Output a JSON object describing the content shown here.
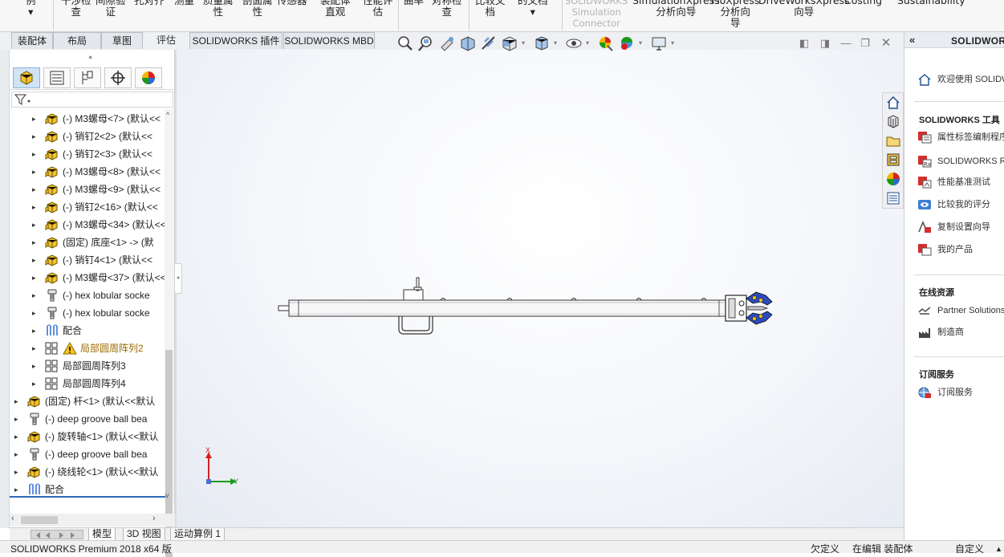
{
  "ribbon": {
    "items": [
      {
        "label": "例\n▾",
        "disabled": false
      },
      {
        "label": "干涉检\n查",
        "disabled": false
      },
      {
        "label": "间隙验\n证",
        "disabled": false
      },
      {
        "label": "孔对齐",
        "disabled": false
      },
      {
        "label": "测量",
        "disabled": false
      },
      {
        "label": "质量属\n性",
        "disabled": false
      },
      {
        "label": "剖面属\n性",
        "disabled": false
      },
      {
        "label": "传感器",
        "disabled": false
      },
      {
        "label": "装配体\n直观",
        "disabled": false
      },
      {
        "label": "性能评\n估",
        "disabled": false
      },
      {
        "label": "曲率",
        "disabled": false
      },
      {
        "label": "对称检\n查",
        "disabled": false
      },
      {
        "label": "比较文\n档",
        "disabled": false
      },
      {
        "label": "的文档\n▾",
        "disabled": false
      },
      {
        "label": "SOLIDWORKS\nSimulation\nConnector",
        "disabled": true
      },
      {
        "label": "SimulationXpress\n分析向导",
        "disabled": false
      },
      {
        "label": "FloXpress\n分析向\n导",
        "disabled": false
      },
      {
        "label": "DriveWorksXpress\n向导",
        "disabled": false
      },
      {
        "label": "Costing",
        "disabled": false
      },
      {
        "label": "Sustainability",
        "disabled": false
      }
    ]
  },
  "command_tabs": [
    "装配体",
    "布局",
    "草图",
    "评估",
    "SOLIDWORKS 插件",
    "SOLIDWORKS MBD"
  ],
  "heads_up_icons": [
    "zoom-to-fit-icon",
    "zoom-to-area-icon",
    "previous-view-icon",
    "section-view-icon",
    "dynamic-annotation-icon",
    "view-orientation-icon",
    "display-style-icon",
    "hide-show-items-icon",
    "edit-appearance-icon",
    "apply-scene-icon",
    "view-settings-icon"
  ],
  "feature_tree": {
    "tabs": [
      "featuremanager-icon",
      "propertymanager-icon",
      "configurationmanager-icon",
      "dimxpertmanager-icon",
      "displaymanager-icon"
    ],
    "items": [
      {
        "label": "(-) M3螺母<7> (默认<<",
        "icon": "part",
        "level": 1,
        "warn": false
      },
      {
        "label": "(-) 销钉2<2> (默认<<",
        "icon": "part",
        "level": 1,
        "warn": false
      },
      {
        "label": "(-) 销钉2<3> (默认<<",
        "icon": "part",
        "level": 1,
        "warn": false
      },
      {
        "label": "(-) M3螺母<8> (默认<<",
        "icon": "part",
        "level": 1,
        "warn": false
      },
      {
        "label": "(-) M3螺母<9> (默认<<",
        "icon": "part",
        "level": 1,
        "warn": false
      },
      {
        "label": "(-) 销钉2<16> (默认<<",
        "icon": "part",
        "level": 1,
        "warn": false
      },
      {
        "label": "(-) M3螺母<34> (默认<<",
        "icon": "part",
        "level": 1,
        "warn": false
      },
      {
        "label": "(固定) 底座<1> -> (默",
        "icon": "part",
        "level": 1,
        "warn": false
      },
      {
        "label": "(-) 销钉4<1> (默认<<",
        "icon": "part",
        "level": 1,
        "warn": false
      },
      {
        "label": "(-) M3螺母<37> (默认<<",
        "icon": "part",
        "level": 1,
        "warn": false
      },
      {
        "label": "(-) hex lobular socke",
        "icon": "screw",
        "level": 1,
        "warn": false
      },
      {
        "label": "(-) hex lobular socke",
        "icon": "screw",
        "level": 1,
        "warn": false
      },
      {
        "label": "配合",
        "icon": "mates",
        "level": 1,
        "warn": false
      },
      {
        "label": "局部圆周阵列2",
        "icon": "pattern",
        "level": 1,
        "warn": true
      },
      {
        "label": "局部圆周阵列3",
        "icon": "pattern",
        "level": 1,
        "warn": false
      },
      {
        "label": "局部圆周阵列4",
        "icon": "pattern",
        "level": 1,
        "warn": false
      },
      {
        "label": "(固定) 杆<1> (默认<<默认",
        "icon": "part",
        "level": 0,
        "warn": false
      },
      {
        "label": "(-) deep groove ball bea",
        "icon": "screw",
        "level": 0,
        "warn": false
      },
      {
        "label": "(-) 旋转轴<1> (默认<<默认",
        "icon": "part",
        "level": 0,
        "warn": false
      },
      {
        "label": "(-) deep groove ball bea",
        "icon": "screw",
        "level": 0,
        "warn": false
      },
      {
        "label": "(-) 绕线轮<1> (默认<<默认",
        "icon": "part",
        "level": 0,
        "warn": false
      },
      {
        "label": "配合",
        "icon": "mates",
        "level": 0,
        "warn": false
      }
    ]
  },
  "viewport": {
    "triad": {
      "x_label": "Y",
      "y_label": "X"
    }
  },
  "bottom_tabs": [
    "模型",
    "3D 视图",
    "运动算例 1"
  ],
  "status": {
    "left": "SOLIDWORKS Premium 2018 x64 版",
    "definition": "欠定义",
    "mode": "在编辑 装配体",
    "units": "自定义",
    "arrow": "▲"
  },
  "task_pane": {
    "title": "SOLIDWORKS 资源",
    "welcome": "欢迎使用 SOLIDWORKS",
    "tools_heading": "SOLIDWORKS 工具",
    "tools": [
      {
        "label": "属性标签编制程序",
        "icon": "property-tab-builder-icon"
      },
      {
        "label": "SOLIDWORKS Rx",
        "icon": "rx-icon"
      },
      {
        "label": "性能基准测试",
        "icon": "benchmark-icon"
      },
      {
        "label": "比较我的评分",
        "icon": "compare-score-icon"
      },
      {
        "label": "复制设置向导",
        "icon": "copy-settings-icon"
      },
      {
        "label": "我的产品",
        "icon": "my-products-icon"
      }
    ],
    "online_heading": "在线资源",
    "online": [
      {
        "label": "Partner Solutions",
        "icon": "partner-solutions-icon"
      },
      {
        "label": "制造商",
        "icon": "manufacturers-icon"
      }
    ],
    "subscription_heading": "订阅服务",
    "subscription": [
      {
        "label": "订阅服务",
        "icon": "subscription-icon"
      }
    ]
  },
  "colors": {
    "accent": "#2f6db5",
    "part_yellow": "#f2c230",
    "warning": "#f5c518",
    "axis_red": "#d62020",
    "axis_green": "#1a9a1a",
    "sw_red": "#d32f2f"
  }
}
